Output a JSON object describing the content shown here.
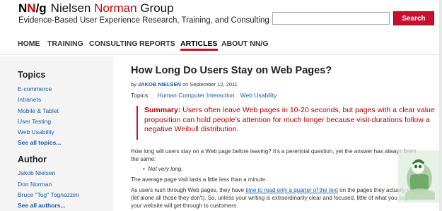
{
  "header": {
    "logo_nng_first": "N",
    "logo_nng_red": "N",
    "logo_nng_last": "/g",
    "logo_brand_first": "Nielsen",
    "logo_brand_red": "Norman",
    "logo_brand_last": "Group",
    "tagline": "Evidence-Based User Experience Research, Training, and Consulting",
    "search_placeholder": "",
    "search_button": "Search"
  },
  "nav": {
    "items": [
      {
        "label": "HOME",
        "active": false
      },
      {
        "label": "TRAINING",
        "active": false
      },
      {
        "label": "CONSULTING",
        "active": false
      },
      {
        "label": "REPORTS",
        "active": false
      },
      {
        "label": "ARTICLES",
        "active": true
      },
      {
        "label": "ABOUT NN/G",
        "active": false
      }
    ]
  },
  "sidebar": {
    "topics_heading": "Topics",
    "topics": [
      "E-commerce",
      "Intranets",
      "Mobile & Tablet",
      "User Testing",
      "Web Usability"
    ],
    "topics_more": "See all topics...",
    "author_heading": "Author",
    "authors": [
      "Jakob Nielsen",
      "Don Norman",
      "Bruce \"Tog\" Tognazzini"
    ],
    "authors_more": "See all authors..."
  },
  "article": {
    "title": "How Long Do Users Stay on Web Pages?",
    "by_prefix": "by",
    "author": "JAKOB NIELSEN",
    "date_text": "on September 12, 2011",
    "topics_label": "Topics:",
    "topics": [
      "Human Computer Interaction",
      "Web Usability"
    ],
    "summary_label": "Summary:",
    "summary_text": "Users often leave Web pages in 10-20 seconds, but pages with a clear value proposition can hold people's attention for much longer because visit-durations follow a negative Weibull distribution.",
    "para1": "How long will users stay on a Web page before leaving? It's a perennial question, yet the answer has always been",
    "para1b": "the same:",
    "bullet": "Not very long.",
    "para2": "The average page visit lasts a little less than a minute.",
    "para3_start": "As users rush through Web pages, they have",
    "para3_link": "time to read only a quarter of the text",
    "para3_end": "on the pages they actually visit",
    "para3_line2": "(let alone all those they don't). So, unless your writing is extraordinarily clear and focused, little of what you say on",
    "para3_line3": "your website will get through to customers."
  },
  "colors": {
    "accent": "#c8102e",
    "link": "#1a5aa8",
    "summary_text": "#b30000",
    "sidebar_bg": "#f4f4f4"
  },
  "icons": {
    "watermark": "character-logo"
  }
}
